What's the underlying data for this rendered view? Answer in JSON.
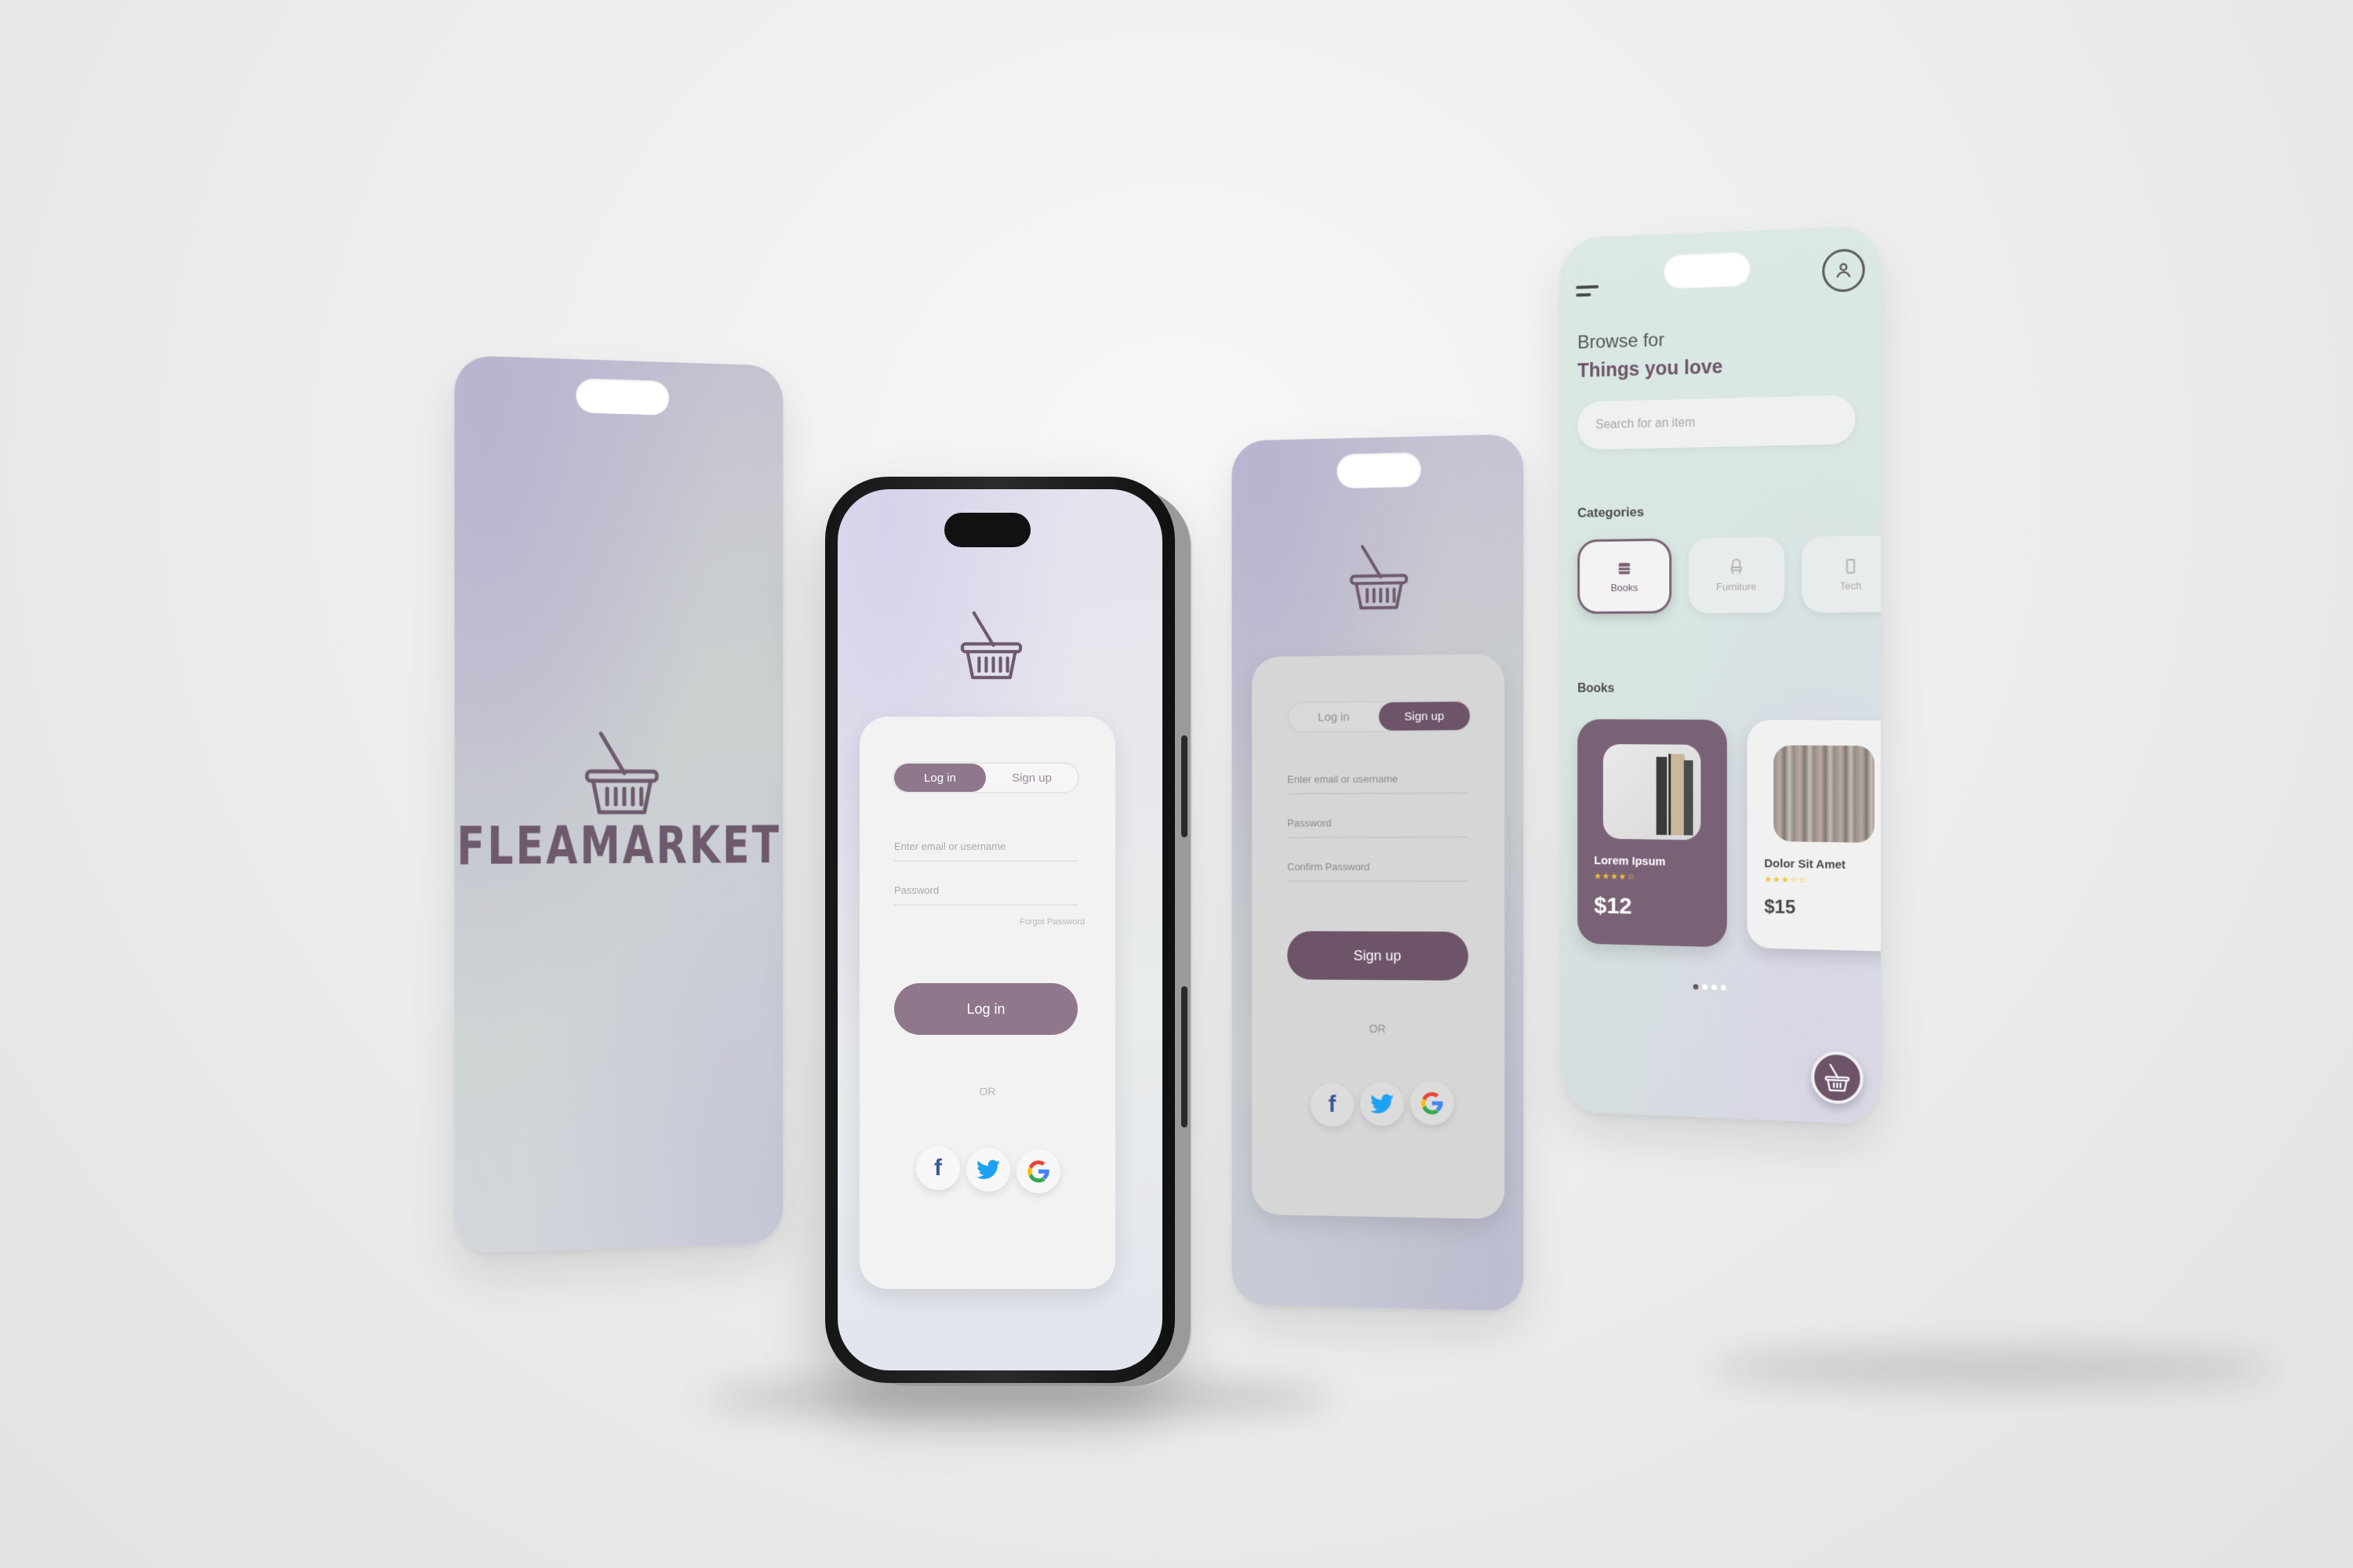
{
  "splash": {
    "brand": "FLEAMARKET"
  },
  "login_screen": {
    "tabs": [
      {
        "label": "Log in",
        "active": true
      },
      {
        "label": "Sign up",
        "active": false
      }
    ],
    "email_placeholder": "Enter email or username",
    "password_placeholder": "Password",
    "forgot_password": "Forgot Password",
    "submit_label": "Log in",
    "or_text": "OR",
    "social": [
      {
        "name": "facebook-icon",
        "glyph": "f",
        "color": "#3b5998"
      },
      {
        "name": "twitter-icon",
        "glyph": "t",
        "color": "#1da1f2"
      },
      {
        "name": "google-icon",
        "glyph": "G",
        "color": "#ea4335"
      }
    ]
  },
  "signup_screen": {
    "tabs": [
      {
        "label": "Log in",
        "active": false
      },
      {
        "label": "Sign up",
        "active": true
      }
    ],
    "email_placeholder": "Enter email or username",
    "password_placeholder": "Password",
    "confirm_placeholder": "Confirm Password",
    "submit_label": "Sign up",
    "or_text": "OR"
  },
  "browse_screen": {
    "greeting": "Browse for",
    "title": "Things you love",
    "search_placeholder": "Search for an item",
    "categories_label": "Categories",
    "categories": [
      {
        "label": "Books",
        "icon": "book-icon",
        "active": true
      },
      {
        "label": "Furniture",
        "icon": "chair-icon",
        "active": false
      },
      {
        "label": "Tech",
        "icon": "phone-icon",
        "active": false
      }
    ],
    "books_label": "Books",
    "books": [
      {
        "name": "Lorem Ipsum",
        "stars": "★★★★☆",
        "price": "$12"
      },
      {
        "name": "Dolor Sit Amet",
        "stars": "★★★☆☆",
        "price": "$15"
      }
    ],
    "carousel_pages": 4,
    "carousel_active": 1
  },
  "colors": {
    "brand": "#6d5468",
    "brand_light": "#8f778c",
    "card": "#f2f2f2",
    "background": "#ebebeb"
  }
}
